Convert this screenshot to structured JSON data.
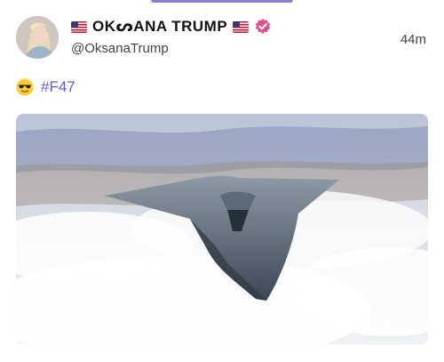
{
  "post": {
    "author": {
      "display_name": "OKᔕANA TRUMP",
      "handle": "@OksanaTrump",
      "verified": true
    },
    "timestamp": "44m",
    "text": {
      "emoji": "sunglasses-emoji",
      "hashtag": "#F47"
    },
    "media": {
      "type": "image",
      "depicts": "fighter-jet-over-clouds"
    }
  },
  "colors": {
    "hashtag": "#6a5acd",
    "verified_badge": "#e0508a",
    "top_strip": "#8a80d6"
  }
}
